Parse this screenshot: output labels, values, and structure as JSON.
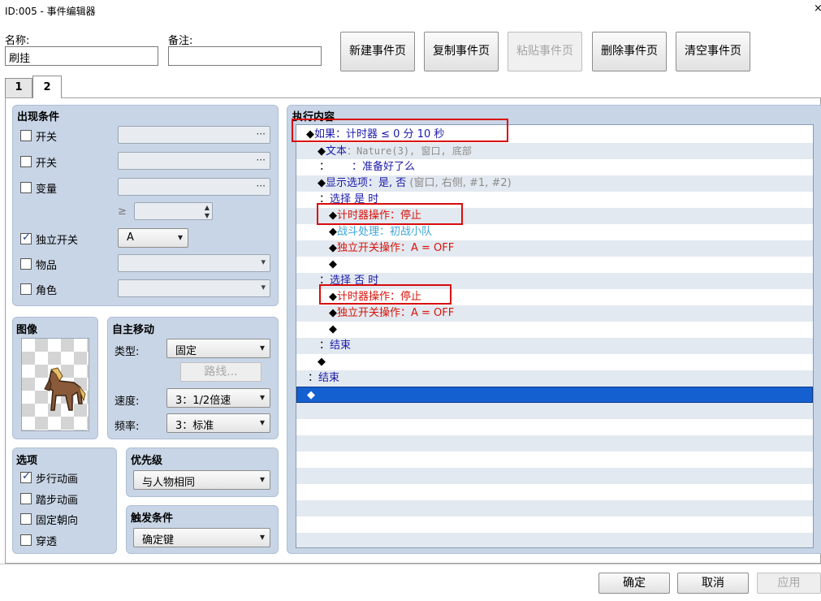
{
  "window": {
    "title": "ID:005 - 事件编辑器",
    "close_glyph": "×"
  },
  "header": {
    "name_label": "名称:",
    "name_value": "刷挂",
    "note_label": "备注:",
    "note_value": "",
    "buttons": {
      "new_page": "新建事件页",
      "copy_page": "复制事件页",
      "paste_page": "粘贴事件页",
      "delete_page": "删除事件页",
      "clear_page": "清空事件页"
    }
  },
  "tabs": [
    {
      "label": "1"
    },
    {
      "label": "2"
    }
  ],
  "active_tab": "2",
  "conditions": {
    "title": "出现条件",
    "switch1_label": "开关",
    "switch2_label": "开关",
    "variable_label": "变量",
    "variable_op": "≥",
    "self_switch_label": "独立开关",
    "self_switch_checked": true,
    "self_switch_value": "A",
    "item_label": "物品",
    "actor_label": "角色",
    "ellipsis": "···"
  },
  "image": {
    "title": "图像"
  },
  "autonomous": {
    "title": "自主移动",
    "type_label": "类型:",
    "type_value": "固定",
    "route_button": "路线...",
    "speed_label": "速度:",
    "speed_value": "3：1/2倍速",
    "freq_label": "频率:",
    "freq_value": "3：标准"
  },
  "options": {
    "title": "选项",
    "items": [
      {
        "label": "步行动画",
        "checked": true
      },
      {
        "label": "踏步动画",
        "checked": false
      },
      {
        "label": "固定朝向",
        "checked": false
      },
      {
        "label": "穿透",
        "checked": false
      }
    ]
  },
  "priority": {
    "title": "优先级",
    "value": "与人物相同"
  },
  "trigger": {
    "title": "触发条件",
    "value": "确定键"
  },
  "contents": {
    "title": "执行内容",
    "lines": [
      {
        "prefix": "◆",
        "text": "如果：计时器 ≤ 0 分 10 秒"
      },
      {
        "prefix": "◆",
        "label": "文本",
        "text": "：Nature(3), 窗口, 底部"
      },
      {
        "prefix": "：",
        "text": "：准备好了么"
      },
      {
        "prefix": "◆",
        "label": "显示选项",
        "text": "：是, 否",
        "extra": "(窗口, 右侧, #1, #2)"
      },
      {
        "prefix": "：",
        "text": "选择 是 时"
      },
      {
        "prefix": "◆",
        "text": "计时器操作：停止"
      },
      {
        "prefix": "◆",
        "text": "战斗处理：初战小队"
      },
      {
        "prefix": "◆",
        "text": "独立开关操作：A = OFF"
      },
      {
        "prefix": "◆",
        "text": ""
      },
      {
        "prefix": "：",
        "text": "选择 否 时"
      },
      {
        "prefix": "◆",
        "text": "计时器操作：停止"
      },
      {
        "prefix": "◆",
        "text": "独立开关操作：A = OFF"
      },
      {
        "prefix": "◆",
        "text": ""
      },
      {
        "prefix": "：",
        "text": "结束"
      },
      {
        "prefix": "◆",
        "text": ""
      },
      {
        "prefix": "：",
        "text": "结束"
      },
      {
        "prefix": "◆",
        "text": ""
      }
    ]
  },
  "footer": {
    "ok": "确定",
    "cancel": "取消",
    "apply": "应用"
  }
}
